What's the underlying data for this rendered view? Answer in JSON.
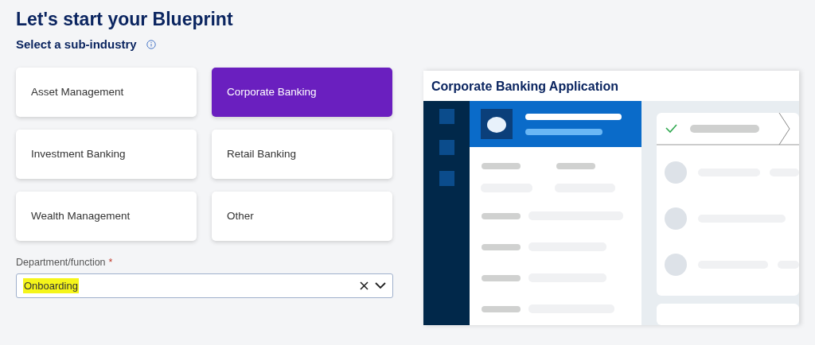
{
  "title": "Let's start your Blueprint",
  "subtitle": "Select a sub-industry",
  "options": [
    {
      "label": "Asset Management",
      "selected": false
    },
    {
      "label": "Corporate Banking",
      "selected": true
    },
    {
      "label": "Investment Banking",
      "selected": false
    },
    {
      "label": "Retail Banking",
      "selected": false
    },
    {
      "label": "Wealth Management",
      "selected": false
    },
    {
      "label": "Other",
      "selected": false
    }
  ],
  "department": {
    "label": "Department/function",
    "required_mark": "*",
    "value": "Onboarding",
    "highlighted": true
  },
  "preview": {
    "title": "Corporate Banking Application"
  }
}
